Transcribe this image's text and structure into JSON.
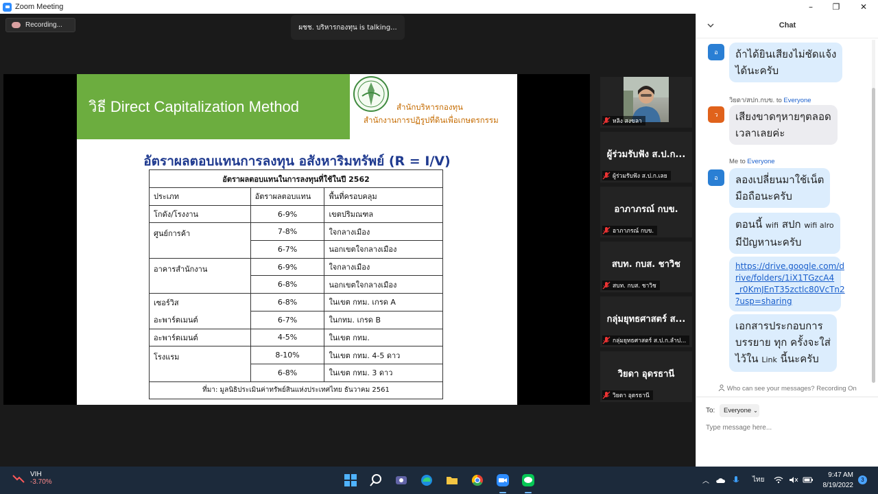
{
  "window": {
    "title": "Zoom Meeting",
    "minimize": "–",
    "maximize": "❐",
    "close": "✕"
  },
  "meeting": {
    "recording_label": "Recording...",
    "talking_banner": "ผชช. บริหารกองทุน is talking..."
  },
  "slide": {
    "banner_title": "วิธี Direct Capitalization Method",
    "org_line1": "สำนักบริหารกองทุน",
    "org_line2": "สำนักงานการปฏิรูปที่ดินเพื่อเกษตรกรรม",
    "heading": "อัตราผลตอบแทนการลงทุน อสังหาริมทรัพย์ (R = I/V)",
    "table": {
      "caption": "อัตราผลตอบแทนในการลงทุนที่ใช้ในปี 2562",
      "columns": [
        "ประเภท",
        "อัตราผลตอบแทน",
        "พื้นที่ครอบคลุม"
      ],
      "rows": [
        [
          "โกดัง/โรงงาน",
          "6-9%",
          "เขตปริมณฑล"
        ],
        [
          "ศูนย์การค้า",
          "7-8%",
          "ใจกลางเมือง"
        ],
        [
          "",
          "6-7%",
          "นอกเขตใจกลางเมือง"
        ],
        [
          "อาคารสำนักงาน",
          "6-9%",
          "ใจกลางเมือง"
        ],
        [
          "",
          "6-8%",
          "นอกเขตใจกลางเมือง"
        ],
        [
          "เซอร์วิส",
          "6-8%",
          "ในเขต กทม. เกรด A"
        ],
        [
          "อะพาร์ตเมนต์",
          "6-7%",
          "ในกทม. เกรด B"
        ],
        [
          "อะพาร์ตเมนต์",
          "4-5%",
          "ในเขต กทม."
        ],
        [
          "โรงแรม",
          "8-10%",
          "ในเขต กทม. 4-5 ดาว"
        ],
        [
          "",
          "6-8%",
          "ในเขต กทม. 3 ดาว"
        ]
      ],
      "source": "ที่มา: มูลนิธิประเมินค่าทรัพย์สินแห่งประเทศไทย ธันวาคม 2561"
    }
  },
  "gallery": [
    {
      "big": "",
      "label": "หลิง สงขลา",
      "video": true
    },
    {
      "big": "ผู้ร่วมรับฟัง ส.ป.ก...",
      "label": "ผู้ร่วมรับฟัง ส.ป.ก.เลย",
      "video": false
    },
    {
      "big": "อาภาภรณ์ กบข.",
      "label": "อาภาภรณ์ กบข.",
      "video": false
    },
    {
      "big": "สบท. กบส. ชาวิช",
      "label": "สบท. กบส. ชาวิช",
      "video": false
    },
    {
      "big": "กลุ่มยุทธศาสตร์ ส...",
      "label": "กลุ่มยุทธศาสตร์ ส.ป.ก.ลำป...",
      "video": false
    },
    {
      "big": "วิยดา อุดรธานี",
      "label": "วิยดา อุดรธานี",
      "video": false
    }
  ],
  "chat": {
    "title": "Chat",
    "messages": [
      {
        "avatar": "อ",
        "avatar_color": "#2a7fd4",
        "lines": [
          "ถ้าได้ยินเสียงไม่ชัดแจ้ง",
          "ได้นะครับ"
        ],
        "style": "blue"
      },
      {
        "sender": "วิยดา/สปก.กบข.",
        "to_word": "to",
        "to": "Everyone",
        "avatar": "ว",
        "avatar_color": "#e0621b",
        "lines": [
          "เสียงขาดๆหายๆตลอด",
          "เวลาเลยค่ะ"
        ],
        "style": "gray"
      },
      {
        "sender": "Me",
        "to_word": "to",
        "to": "Everyone",
        "avatar": "อ",
        "avatar_color": "#2a7fd4",
        "lines": [
          "ลองเปลี่ยนมาใช้เน็ต",
          "มือถือนะครับ"
        ],
        "style": "blue"
      },
      {
        "line1_a": "ตอนนี้",
        "line1_b": "wifi",
        "line1_c": "สปก",
        "line1_d": "wifi alro",
        "line2": "มีปัญหานะครับ",
        "style": "blue"
      },
      {
        "link_lines": [
          "https://drive.google.com/d",
          "rive/folders/1iX1TGzcA4",
          "_r0KmJEnT35zctlc80VcTn2",
          "?usp=sharing"
        ],
        "style": "blue"
      },
      {
        "line1": "เอกสารประกอบการ",
        "line2": "บรรยาย ทุก ครั้งจะใส่",
        "line3_a": "ไว้ใน",
        "line3_b": "Link",
        "line3_c": "นี้นะครับ",
        "style": "blue"
      }
    ],
    "privacy_note": "Who can see your messages? Recording On",
    "to_label": "To:",
    "to_value": "Everyone",
    "input_placeholder": "Type message here..."
  },
  "taskbar": {
    "stock_name": "VIH",
    "stock_change": "-3.70%",
    "language": "ไทย",
    "time": "9:47 AM",
    "date": "8/19/2022",
    "notifications": "3"
  },
  "colors": {
    "zoom_blue": "#2d8cff",
    "slide_green": "#6cad3f",
    "slide_heading_blue": "#1f3a8f",
    "org_text_orange": "#c56b00",
    "bubble_blue": "#dcedfd",
    "taskbar": "#1c2a3b",
    "stock_down": "#ff8b8b"
  },
  "icons": [
    "zoom-logo-icon",
    "recording-cloud-icon",
    "muted-mic-icon",
    "chevron-down-icon",
    "person-icon",
    "file-icon",
    "emoji-icon",
    "more-icon",
    "windows-start-icon",
    "search-icon",
    "chat-app-icon",
    "edge-icon",
    "folder-icon",
    "chrome-icon",
    "zoom-taskbar-icon",
    "line-app-icon",
    "tray-chevron-icon",
    "onedrive-icon",
    "mic-icon",
    "wifi-icon",
    "speaker-muted-icon",
    "battery-icon"
  ]
}
